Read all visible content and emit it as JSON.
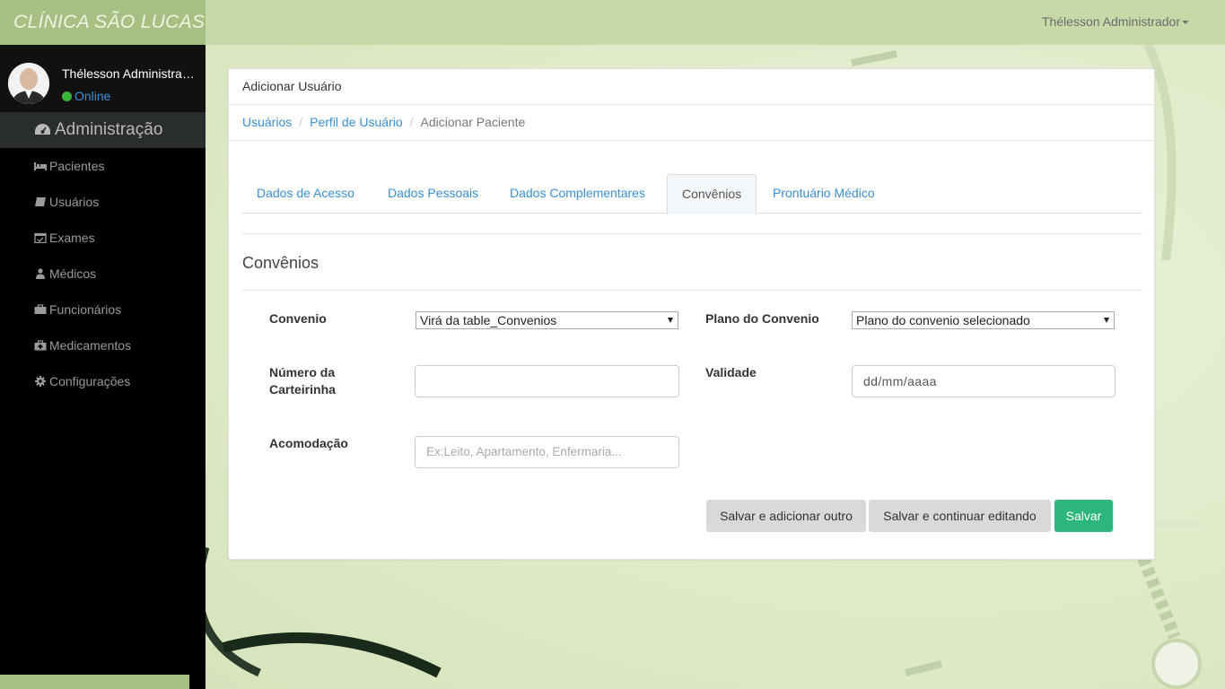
{
  "brand": "CLÍNICA SÃO LUCAS",
  "topbar": {
    "user_menu": "Thélesson Administrador"
  },
  "sidebar": {
    "user_name": "Thélesson Administrador",
    "status": "Online",
    "section": "Administração",
    "items": [
      {
        "label": "Pacientes",
        "icon": "bed-icon"
      },
      {
        "label": "Usuários",
        "icon": "book-icon"
      },
      {
        "label": "Exames",
        "icon": "calendar-check-icon"
      },
      {
        "label": "Médicos",
        "icon": "user-md-icon"
      },
      {
        "label": "Funcionários",
        "icon": "briefcase-icon"
      },
      {
        "label": "Medicamentos",
        "icon": "medkit-icon"
      },
      {
        "label": "Configurações",
        "icon": "gear-icon"
      }
    ]
  },
  "card": {
    "title": "Adicionar Usuário",
    "breadcrumb": [
      "Usuários",
      "Perfil de Usuário",
      "Adicionar Paciente"
    ],
    "tabs": [
      "Dados de Acesso",
      "Dados Pessoais",
      "Dados Complementares",
      "Convênios",
      "Prontuário Médico"
    ],
    "active_tab": "Convênios",
    "section_title": "Convênios"
  },
  "form": {
    "convenio_label": "Convenio",
    "convenio_value": "Virá da table_Convenios",
    "plano_label": "Plano do Convenio",
    "plano_value": "Plano do convenio selecionado",
    "numero_label_line1": "Número da",
    "numero_label_line2": "Carteirinha",
    "numero_value": "",
    "validade_label": "Validade",
    "validade_placeholder": "dd/mm/aaaa",
    "acomodacao_label": "Acomodação",
    "acomodacao_placeholder": "Ex:Leito, Apartamento, Enfermaria..."
  },
  "buttons": {
    "save_add": "Salvar e adicionar outro",
    "save_continue": "Salvar e continuar editando",
    "save": "Salvar"
  },
  "colors": {
    "brand_bg": "#a8bf84",
    "topbar_bg": "#c8d9a8",
    "link": "#3a8fd6",
    "save": "#2db67c"
  }
}
